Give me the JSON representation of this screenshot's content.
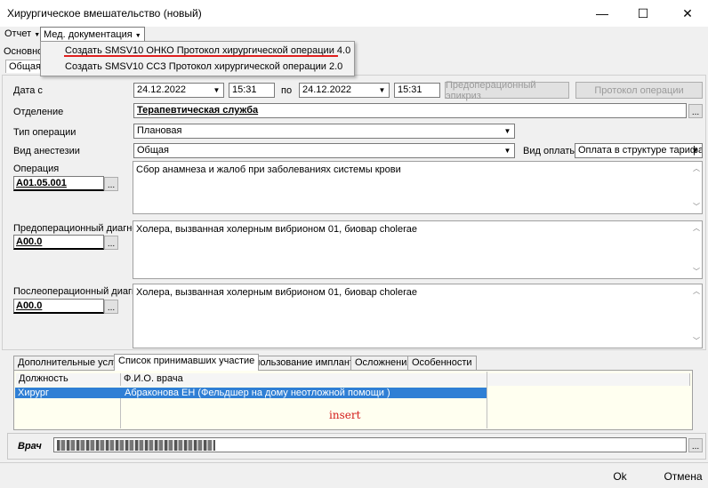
{
  "window": {
    "title": "Хирургическое вмешательство (новый)",
    "minimize_glyph": "—",
    "maximize_glyph": "☐",
    "close_glyph": "✕"
  },
  "menu": {
    "report": "Отчет",
    "med_docs": "Мед. документация",
    "dropdown": [
      "Создать SMSV10 ОНКО Протокол хирургической операции 4.0",
      "Создать SMSV10 ССЗ Протокол хирургической операции 2.0"
    ]
  },
  "tabs_top": {
    "main": "Основно",
    "general": "Общая и"
  },
  "form": {
    "date_label": "Дата с",
    "date_from": "24.12.2022",
    "time_from": "15:31",
    "to_label": "по",
    "date_to": "24.12.2022",
    "time_to": "15:31",
    "preop_epicrisis_button": "Предоперационный эпикриз",
    "op_protocol_button": "Протокол операции",
    "department_label": "Отделение",
    "department_value": "Терапевтическая служба",
    "op_type_label": "Тип операции",
    "op_type_value": "Плановая",
    "anesthesia_label": "Вид анестезии",
    "anesthesia_value": "Общая",
    "payment_label": "Вид оплаты",
    "payment_value": "Оплата в структуре тарифа",
    "operation_label": "Операция",
    "operation_code": "A01.05.001",
    "operation_text": "Сбор анамнеза и жалоб при заболеваниях системы крови",
    "preop_diag_label": "Предоперационный диагноз",
    "preop_diag_code": "A00.0",
    "preop_diag_text": "Холера, вызванная холерным вибрионом 01, биовар cholerae",
    "postop_diag_label": "Послеоперационный диагноз",
    "postop_diag_code": "A00.0",
    "postop_diag_text": "Холера, вызванная холерным вибрионом 01, биовар cholerae",
    "ellipsis": "..."
  },
  "bottom_tabs": [
    "Дополнительные услуги",
    "Список принимавших участие",
    "Использование имплантов",
    "Осложнения",
    "Особенности"
  ],
  "grid": {
    "columns": [
      "Должность",
      "Ф.И.О. врача"
    ],
    "rows": [
      {
        "position": "Хирург",
        "name": "Абраконова ЕН (Фельдшер на дому неотложной помощи )"
      }
    ],
    "insert_text": "insert"
  },
  "doctor": {
    "label": "Врач"
  },
  "footer": {
    "ok": "Ok",
    "cancel": "Отмена"
  }
}
